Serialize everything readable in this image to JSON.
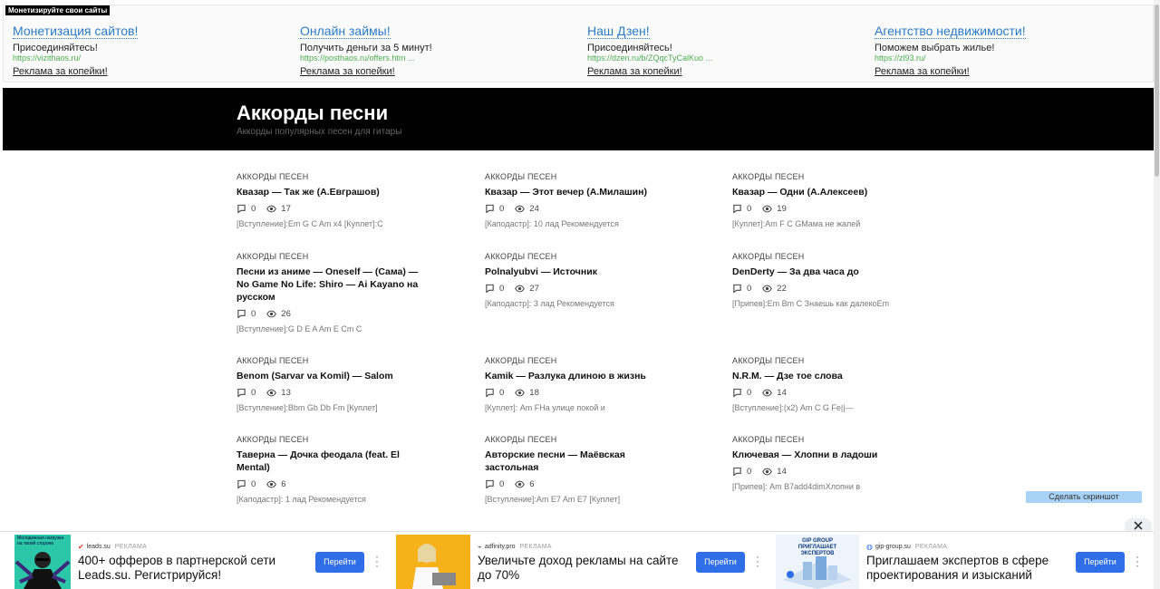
{
  "top_ads": {
    "label": "Монетизируйте свои сайты",
    "items": [
      {
        "title": "Монетизация сайтов!",
        "text": "Присоединяйтесь!",
        "url": "https://vizithaos.ru/",
        "link": "Реклама за копейки!"
      },
      {
        "title": "Онлайн займы!",
        "text": "Получить деньги за 5 минут!",
        "url": "https://posthaos.ru/offers.htm ...",
        "link": "Реклама за копейки!"
      },
      {
        "title": "Наш Дзен!",
        "text": "Присоединяйтесь!",
        "url": "https://dzen.ru/b/ZQqcTyCalKuo ...",
        "link": "Реклама за копейки!"
      },
      {
        "title": "Агентство недвижимости!",
        "text": "Поможем выбрать жилье!",
        "url": "https://zl93.ru/",
        "link": "Реклама за копейки!"
      }
    ]
  },
  "header": {
    "title": "Аккорды песни",
    "subtitle": "Аккорды популярных песен для гитары"
  },
  "posts": [
    {
      "category": "АККОРДЫ ПЕСЕН",
      "title": "Квазар — Так же (А.Евграшов)",
      "comments": "0",
      "views": "17",
      "excerpt": "[Вступление]:Em G C Am x4 [Куплет]:C"
    },
    {
      "category": "АККОРДЫ ПЕСЕН",
      "title": "Квазар — Этот вечер (А.Милашин)",
      "comments": "0",
      "views": "24",
      "excerpt": "[Каподастр]: 10 лад Рекомендуется"
    },
    {
      "category": "АККОРДЫ ПЕСЕН",
      "title": "Квазар — Одни (А.Алексеев)",
      "comments": "0",
      "views": "19",
      "excerpt": "[Куплет]:Am F C GМама не жалей"
    },
    {
      "category": "АККОРДЫ ПЕСЕН",
      "title": "Песни из аниме — Oneself — (Сама) — No Game No Life: Shiro — Ai Kayano на русском",
      "comments": "0",
      "views": "26",
      "excerpt": "[Вступление]:G D E A Am E Cm C"
    },
    {
      "category": "АККОРДЫ ПЕСЕН",
      "title": "Polnalyubvi — Источник",
      "comments": "0",
      "views": "27",
      "excerpt": "[Каподастр]: 3 лад Рекомендуется"
    },
    {
      "category": "АККОРДЫ ПЕСЕН",
      "title": "DenDerty — За два часа до",
      "comments": "0",
      "views": "22",
      "excerpt": "[Припев]:Em Bm C Знаешь как далекоEm"
    },
    {
      "category": "АККОРДЫ ПЕСЕН",
      "title": "Benom (Sarvar va Komil) — Salom",
      "comments": "0",
      "views": "13",
      "excerpt": "[Вступление]:Bbm Gb Db Fm [Куплет]"
    },
    {
      "category": "АККОРДЫ ПЕСЕН",
      "title": "Kamik — Разлука длиною в жизнь",
      "comments": "0",
      "views": "18",
      "excerpt": "[Куплет]: Am FНа улице покой и"
    },
    {
      "category": "АККОРДЫ ПЕСЕН",
      "title": "N.R.M. — Дзе тое слова",
      "comments": "0",
      "views": "14",
      "excerpt": "[Вступление]:(x2) Am C G Fe||—"
    },
    {
      "category": "АККОРДЫ ПЕСЕН",
      "title": "Таверна — Дочка феодала (feat. El Mental)",
      "comments": "0",
      "views": "6",
      "excerpt": "[Каподастр]: 1 лад Рекомендуется"
    },
    {
      "category": "АККОРДЫ ПЕСЕН",
      "title": "Авторские песни — Маёвская застольная",
      "comments": "0",
      "views": "6",
      "excerpt": "[Вступление]:Am E7 Am E7 [Куплет]"
    },
    {
      "category": "АККОРДЫ ПЕСЕН",
      "title": "Ключевая — Хлопни в ладоши",
      "comments": "0",
      "views": "14",
      "excerpt": "[Припев]: Am B7add4dimХлопни в"
    }
  ],
  "screenshot_button": "Сделать скриншот",
  "bottom_ads": [
    {
      "source": "leads.su",
      "tag": "РЕКЛАМА",
      "title": "400+ офферов в партнерской сети Leads.su. Регистрируйся!",
      "button": "Перейти",
      "image_text": "Молодежная нагрузка на твоей стороне"
    },
    {
      "source": "adfinity.pro",
      "tag": "РЕКЛАМА",
      "title": "Увеличьте доход рекламы на сайте до 70%",
      "button": "Перейти"
    },
    {
      "source": "gip-group.su",
      "tag": "РЕКЛАМА",
      "title": "Приглашаем экспертов в сфере проектирования и изысканий",
      "button": "Перейти",
      "image_text": "GIP GROUP ПРИГЛАШАЕТ ЭКСПЕРТОВ"
    }
  ],
  "colors": {
    "accent": "#2a7cc7",
    "url_green": "#4caf50",
    "button_blue": "#2f6ee6",
    "hero_bg": "#000000"
  }
}
